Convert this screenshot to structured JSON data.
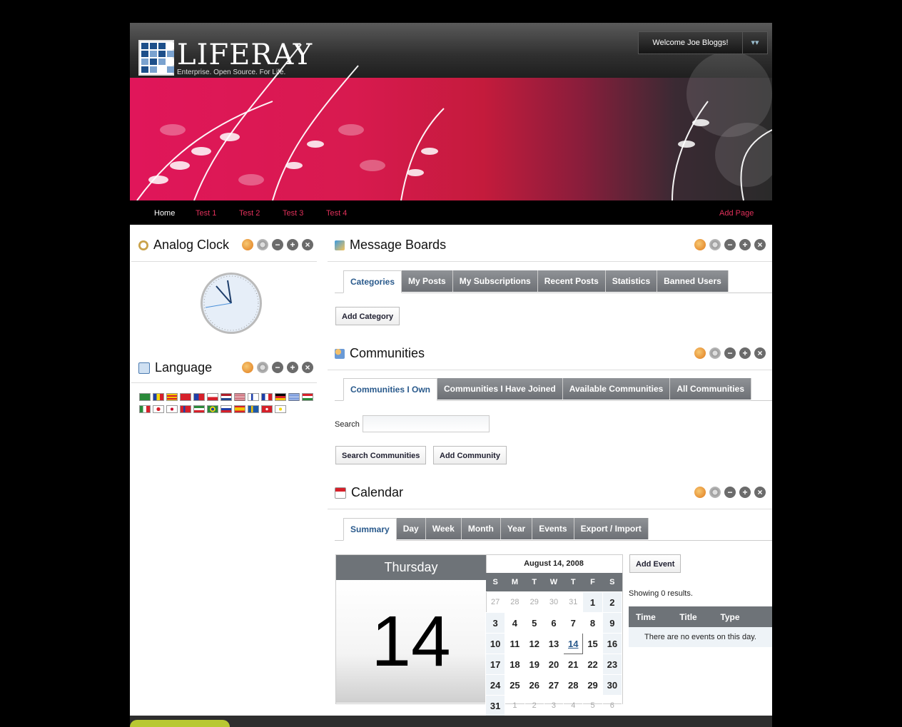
{
  "header": {
    "logo_name": "LIFERAY",
    "logo_tagline": "Enterprise. Open Source. For Life.",
    "welcome": "Welcome Joe Bloggs!",
    "welcome_menu_icon": "dock-dropdown-icon"
  },
  "nav": {
    "items": [
      "Home",
      "Test 1",
      "Test 2",
      "Test 3",
      "Test 4"
    ],
    "add_page": "Add Page",
    "active": "Home",
    "colors": {
      "link": "#e0305a",
      "active": "#ffffff"
    }
  },
  "portlets": {
    "analog_clock": {
      "title": "Analog Clock",
      "time_shown": "11:56"
    },
    "language": {
      "title": "Language",
      "flags_row1": [
        "ar",
        "ca",
        "ca-ES",
        "zh-CN",
        "zh-TW",
        "cs",
        "nl",
        "en-US",
        "fi",
        "fr",
        "de",
        "el",
        "hu"
      ],
      "flags_row2": [
        "it",
        "ja",
        "ko",
        "nb",
        "fa",
        "pt-BR",
        "ru",
        "es",
        "sv",
        "tr",
        "vi"
      ]
    },
    "message_boards": {
      "title": "Message Boards",
      "tabs": [
        "Categories",
        "My Posts",
        "My Subscriptions",
        "Recent Posts",
        "Statistics",
        "Banned Users"
      ],
      "selected_tab": "Categories",
      "add_category": "Add Category"
    },
    "communities": {
      "title": "Communities",
      "tabs": [
        "Communities I Own",
        "Communities I Have Joined",
        "Available Communities",
        "All Communities"
      ],
      "selected_tab": "Communities I Own",
      "search_label": "Search",
      "search_value": "",
      "search_button": "Search Communities",
      "add_button": "Add Community"
    },
    "calendar": {
      "title": "Calendar",
      "tabs": [
        "Summary",
        "Day",
        "Week",
        "Month",
        "Year",
        "Events",
        "Export / Import"
      ],
      "selected_tab": "Summary",
      "day_name": "Thursday",
      "day_number": "14",
      "month_label": "August 14, 2008",
      "weekdays": [
        "S",
        "M",
        "T",
        "W",
        "T",
        "F",
        "S"
      ],
      "weeks": [
        [
          "27",
          "28",
          "29",
          "30",
          "31",
          "1",
          "2"
        ],
        [
          "3",
          "4",
          "5",
          "6",
          "7",
          "8",
          "9"
        ],
        [
          "10",
          "11",
          "12",
          "13",
          "14",
          "15",
          "16"
        ],
        [
          "17",
          "18",
          "19",
          "20",
          "21",
          "22",
          "23"
        ],
        [
          "24",
          "25",
          "26",
          "27",
          "28",
          "29",
          "30"
        ],
        [
          "31",
          "1",
          "2",
          "3",
          "4",
          "5",
          "6"
        ]
      ],
      "add_event": "Add Event",
      "results": "Showing 0 results.",
      "columns": [
        "Time",
        "Title",
        "Type"
      ],
      "empty": "There are no events on this day."
    }
  }
}
